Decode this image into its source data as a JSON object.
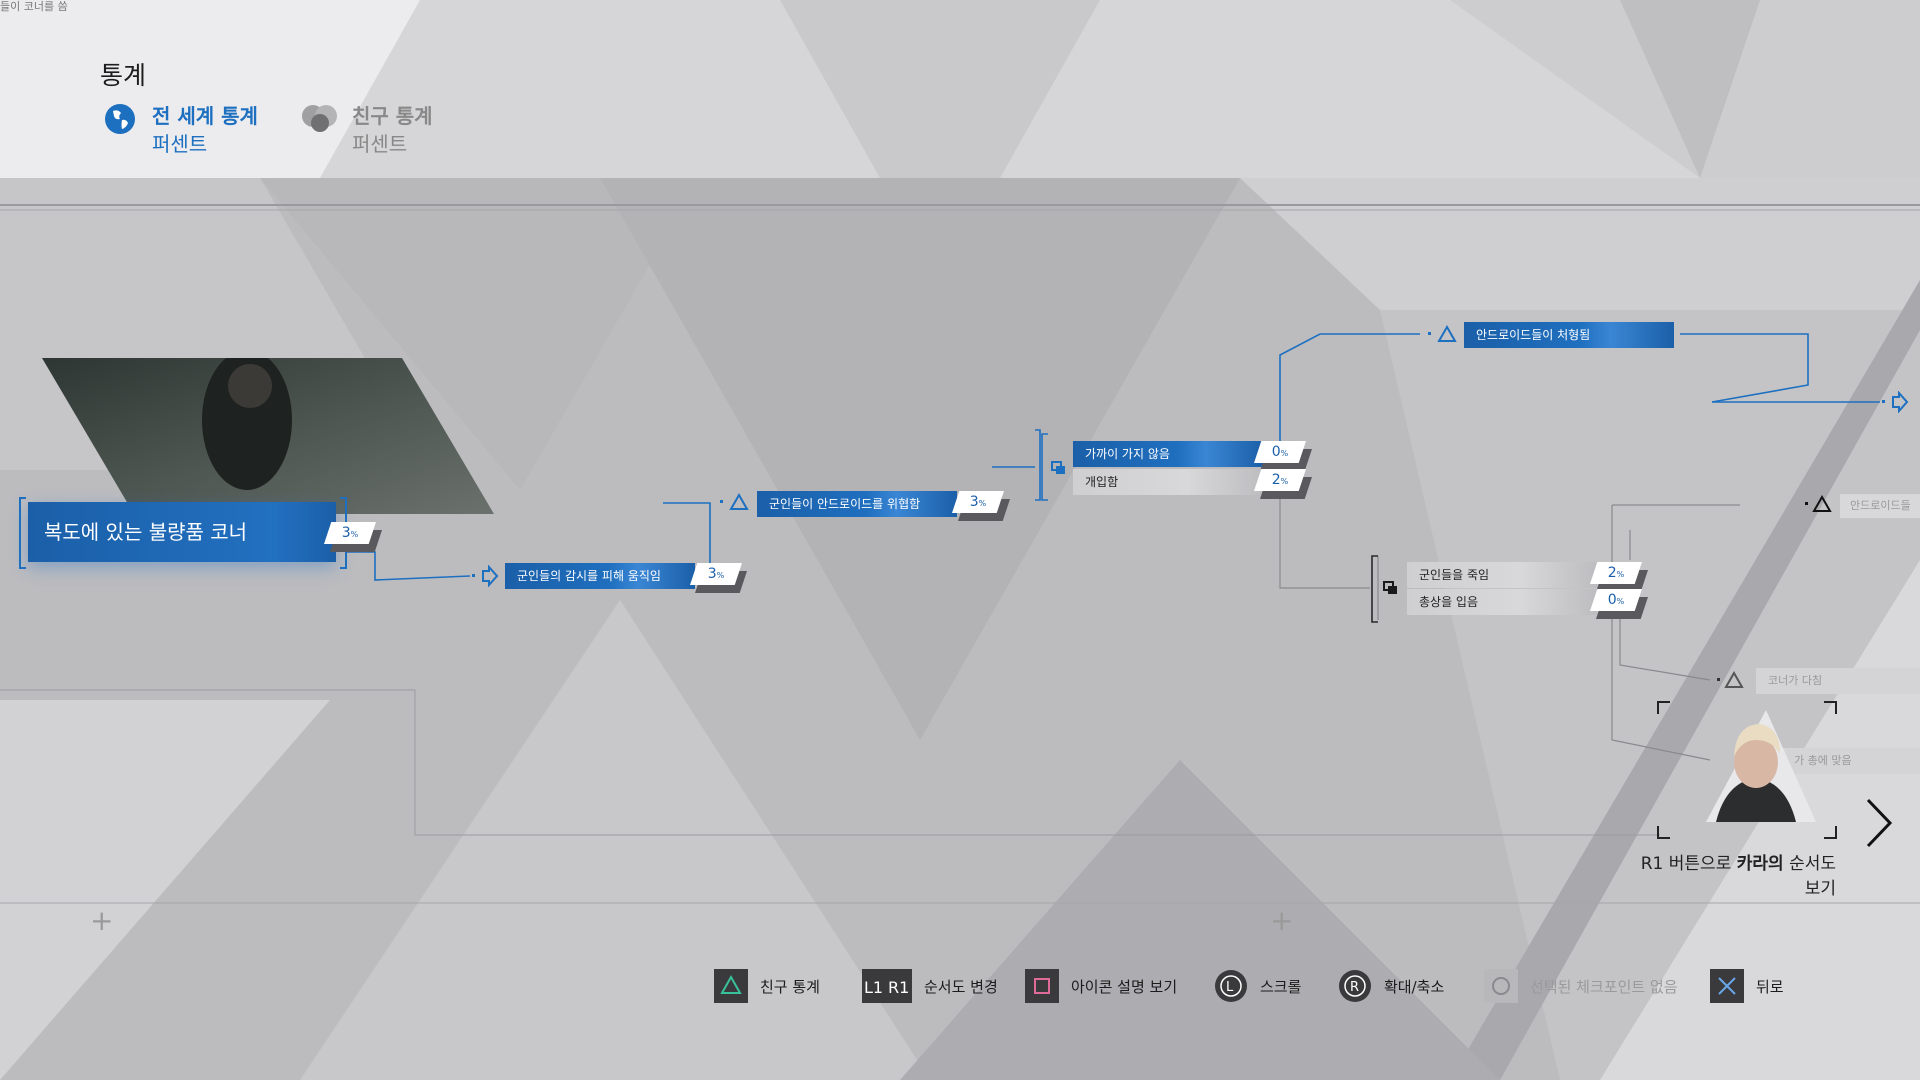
{
  "header": {
    "crumb": "들이 코너를 씀",
    "title": "통계",
    "tabs": [
      {
        "label": "전 세계 통계",
        "sub": "퍼센트",
        "active": true
      },
      {
        "label": "친구 통계",
        "sub": "퍼센트",
        "active": false
      }
    ]
  },
  "flowchart": {
    "start": {
      "label": "복도에 있는 불량품 코너",
      "percent": "3"
    },
    "nodes": {
      "avoid": {
        "label": "군인들의 감시를 피해 움직임",
        "percent": "3"
      },
      "threaten": {
        "label": "군인들이 안드로이드를 위협함",
        "percent": "3"
      },
      "stay_away": {
        "label": "가까이 가지 않음",
        "percent": "0"
      },
      "intervene": {
        "label": "개입함",
        "percent": "2"
      },
      "kill_soldiers": {
        "label": "군인들을 죽임",
        "percent": "2"
      },
      "shot": {
        "label": "총상을 입음",
        "percent": "0"
      },
      "executed": {
        "label": "안드로이드들이 처형됨"
      },
      "faded1": {
        "label": "안드로이드들이"
      },
      "faded2": {
        "label": "코너가 다침"
      },
      "faded3": {
        "label": "가 총에 맞음"
      }
    },
    "percent_unit": "%"
  },
  "kara_hint": {
    "prefix": "R1 버튼으로 ",
    "name": "카라의",
    "suffix": " 순서도 보기"
  },
  "bottom_bar": [
    {
      "icon": "triangle-icon",
      "label": "친구 통계"
    },
    {
      "icon": "l1-r1-icon",
      "label": "순서도 변경",
      "keys": [
        "L1",
        "R1"
      ]
    },
    {
      "icon": "square-icon",
      "label": "아이콘 설명 보기"
    },
    {
      "icon": "left-stick-icon",
      "label": "스크롤",
      "glyph": "L"
    },
    {
      "icon": "right-stick-icon",
      "label": "확대/축소",
      "glyph": "R"
    },
    {
      "icon": "circle-icon",
      "label": "선택된 체크포인트 없음",
      "disabled": true
    },
    {
      "icon": "cross-icon",
      "label": "뒤로"
    }
  ],
  "colors": {
    "accent": "#1b5fa8",
    "highlight": "#1d6fc0",
    "background": "#bdbdc0"
  }
}
